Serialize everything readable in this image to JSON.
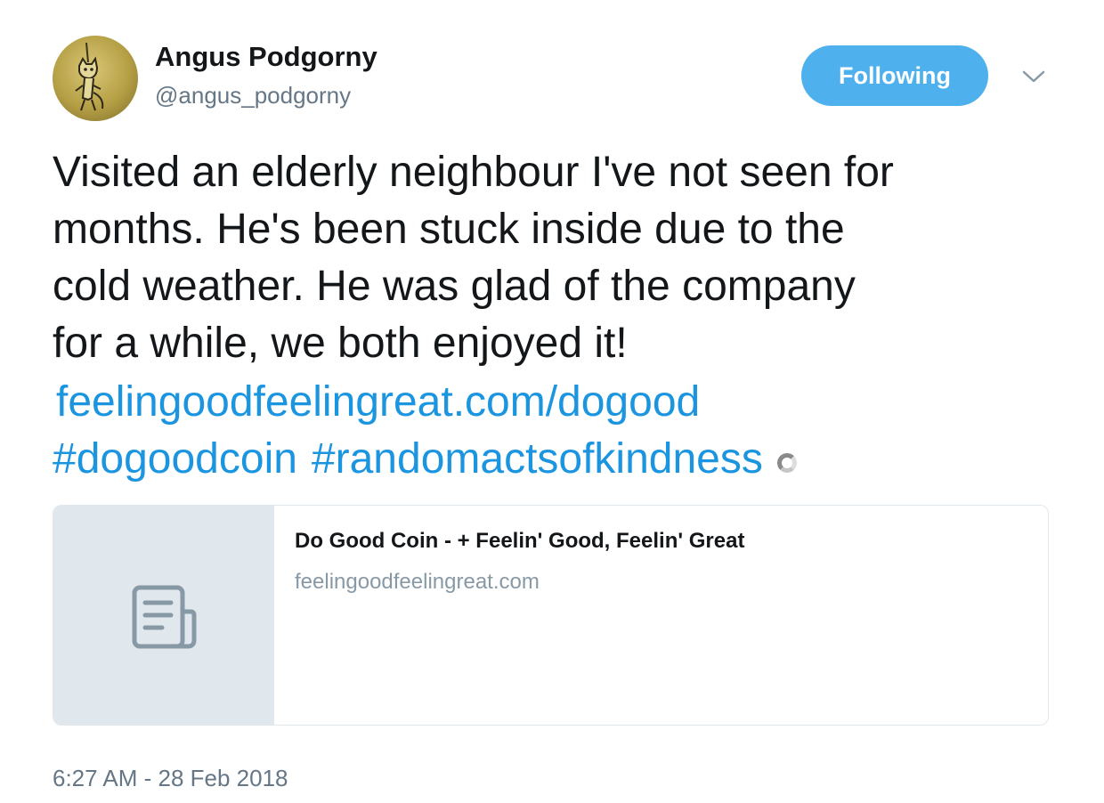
{
  "user": {
    "name": "Angus Podgorny",
    "handle": "@angus_podgorny"
  },
  "follow_button": {
    "label": "Following"
  },
  "tweet": {
    "text": "Visited an elderly neighbour I've not seen for\nmonths. He's been stuck inside due to the\ncold weather. He was glad of the company\nfor a while, we both enjoyed it!",
    "link": "feelingoodfeelingreat.com/dogood",
    "hashtags": [
      "#dogoodcoin",
      "#randomactsofkindness"
    ]
  },
  "card": {
    "title": "Do Good Coin - + Feelin' Good, Feelin' Great",
    "domain": "feelingoodfeelingreat.com",
    "thumbnail_icon": "document-icon"
  },
  "timestamp": "6:27 AM - 28 Feb 2018",
  "colors": {
    "accent": "#1b95e0",
    "button": "#4fb0ee",
    "text": "#14171a",
    "secondary_text": "#657786",
    "card_border": "#e1e8ed"
  }
}
